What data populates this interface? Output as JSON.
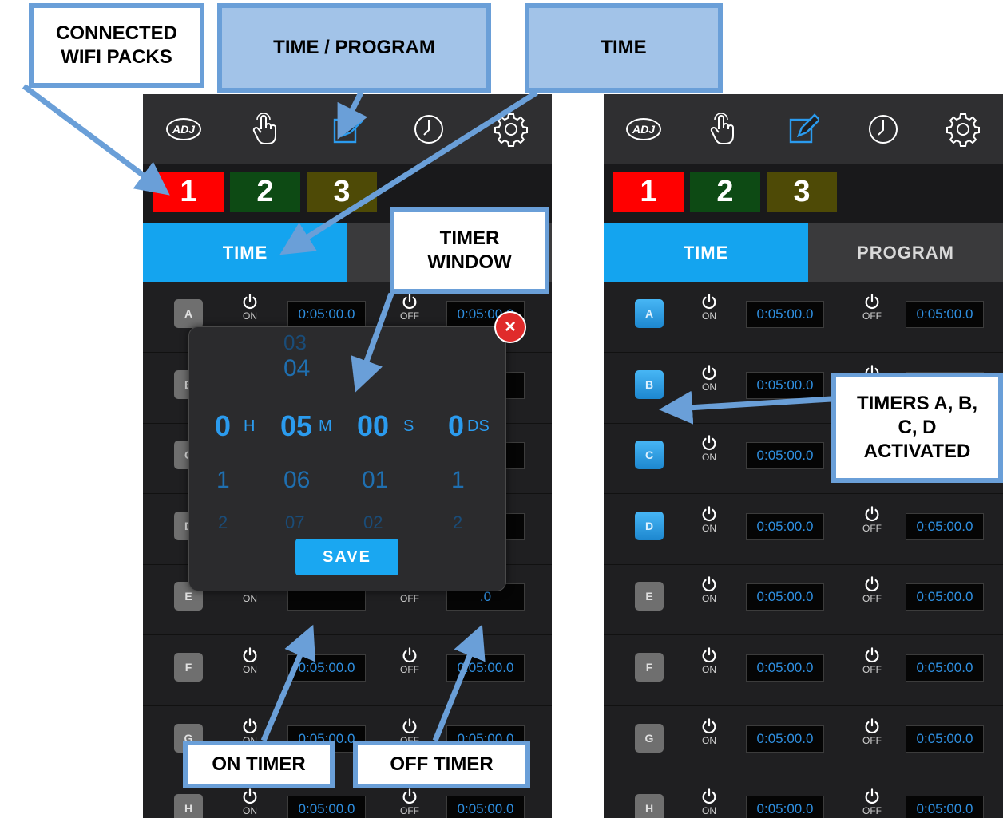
{
  "callouts": {
    "wifi_packs": "CONNECTED WIFI PACKS",
    "time_program": "TIME / PROGRAM",
    "time": "TIME",
    "timer_window": "TIMER WINDOW",
    "on_timer": "ON TIMER",
    "off_timer": "OFF TIMER",
    "timers_activated": "TIMERS A, B, C, D ACTIVATED"
  },
  "nav": {
    "icons": [
      "adj-logo-icon",
      "touch-icon",
      "edit-icon",
      "clock-icon",
      "gear-icon"
    ],
    "active": "edit-icon"
  },
  "packs": [
    {
      "label": "1",
      "color": "#ff0000"
    },
    {
      "label": "2",
      "color": "#0d4a14"
    },
    {
      "label": "3",
      "color": "#4e4a06"
    }
  ],
  "tabs": {
    "time": "TIME",
    "program": "PROGRAM"
  },
  "labels": {
    "on": "ON",
    "off": "OFF"
  },
  "left_screen": {
    "rows": [
      {
        "id": "A",
        "on_time": "0:05:00.0",
        "off_time": "0:05:00.0"
      },
      {
        "id": "B",
        "on_time": "",
        "off_time": ".0"
      },
      {
        "id": "C",
        "on_time": "",
        "off_time": ".0"
      },
      {
        "id": "D",
        "on_time": "",
        "off_time": ".0"
      },
      {
        "id": "E",
        "on_time": "",
        "off_time": ".0"
      },
      {
        "id": "F",
        "on_time": "0:05:00.0",
        "off_time": "0:05:00.0"
      },
      {
        "id": "G",
        "on_time": "0:05:00.0",
        "off_time": "0:05:00.0"
      },
      {
        "id": "H",
        "on_time": "0:05:00.0",
        "off_time": "0:05:00.0"
      }
    ]
  },
  "timer_window": {
    "above2": {
      "m": "03"
    },
    "above1": {
      "m": "04"
    },
    "selected": {
      "h": "0",
      "m": "05",
      "s": "00",
      "ds": "0"
    },
    "units": {
      "h": "H",
      "m": "M",
      "s": "S",
      "ds": "DS"
    },
    "below1": {
      "h": "1",
      "m": "06",
      "s": "01",
      "ds": "1"
    },
    "below2": {
      "h": "2",
      "m": "07",
      "s": "02",
      "ds": "2"
    },
    "save": "SAVE"
  },
  "right_screen": {
    "rows": [
      {
        "id": "A",
        "active": true,
        "on_time": "0:05:00.0",
        "off_time": "0:05:00.0"
      },
      {
        "id": "B",
        "active": true,
        "on_time": "0:05:00.0",
        "off_time": "0:05:00.0"
      },
      {
        "id": "C",
        "active": true,
        "on_time": "0:05:00.0",
        "off_time": "0:05:00.0"
      },
      {
        "id": "D",
        "active": true,
        "on_time": "0:05:00.0",
        "off_time": "0:05:00.0"
      },
      {
        "id": "E",
        "active": false,
        "on_time": "0:05:00.0",
        "off_time": "0:05:00.0"
      },
      {
        "id": "F",
        "active": false,
        "on_time": "0:05:00.0",
        "off_time": "0:05:00.0"
      },
      {
        "id": "G",
        "active": false,
        "on_time": "0:05:00.0",
        "off_time": "0:05:00.0"
      },
      {
        "id": "H",
        "active": false,
        "on_time": "0:05:00.0",
        "off_time": "0:05:00.0"
      }
    ]
  }
}
